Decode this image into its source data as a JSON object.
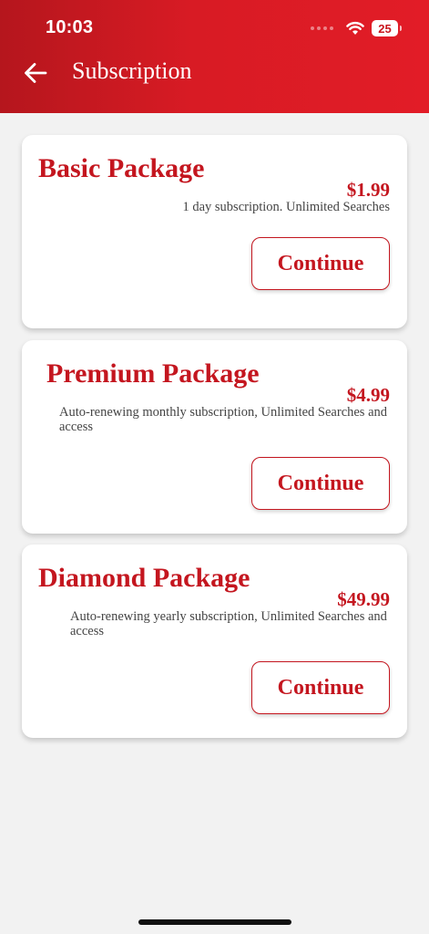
{
  "status_bar": {
    "time": "10:03",
    "battery": "25",
    "icons": [
      "cellular-dots-icon",
      "wifi-icon",
      "battery-icon"
    ]
  },
  "header": {
    "title": "Subscription",
    "back_icon": "arrow-left-icon"
  },
  "colors": {
    "brand_red": "#c4161f",
    "header_red": "#e21c27",
    "background": "#f2f2f2",
    "card": "#ffffff"
  },
  "packages": [
    {
      "title": "Basic Package",
      "price": "$1.99",
      "description": "1 day subscription. Unlimited Searches",
      "button_label": "Continue"
    },
    {
      "title": "Premium Package",
      "price": "$4.99",
      "description": "Auto-renewing monthly subscription, Unlimited Searches and access",
      "button_label": "Continue"
    },
    {
      "title": "Diamond Package",
      "price": "$49.99",
      "description": "Auto-renewing yearly subscription, Unlimited Searches and access",
      "button_label": "Continue"
    }
  ]
}
